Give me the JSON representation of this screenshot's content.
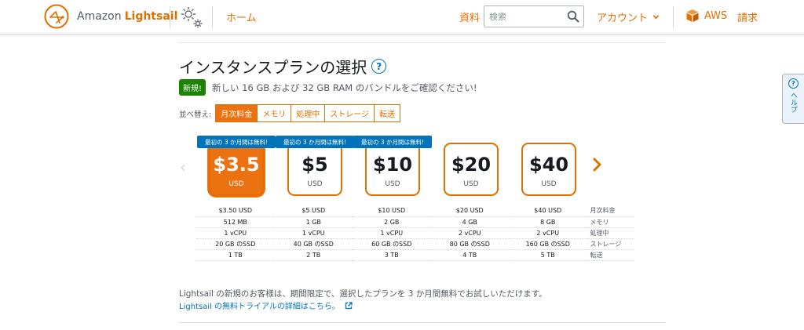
{
  "header": {
    "brand_prefix": "Amazon",
    "brand_name": "Lightsail",
    "home": "ホーム",
    "docs": "資料",
    "search_placeholder": "検索",
    "account": "アカウント",
    "aws": "AWS",
    "billing": "請求"
  },
  "page": {
    "title": "インスタンスプランの選択",
    "help_symbol": "?",
    "new_badge": "新規!",
    "new_text": "新しい 16 GB および 32 GB RAM のバンドルをご確認ください!"
  },
  "sort": {
    "label": "並べ替え:",
    "options": [
      "月次料金",
      "メモリ",
      "処理中",
      "ストレージ",
      "転送"
    ],
    "active": "月次料金"
  },
  "plans": [
    {
      "price": "$3.5",
      "currency": "USD",
      "promo": "最初の 3 か月間は無料!",
      "selected": true
    },
    {
      "price": "$5",
      "currency": "USD",
      "promo": "最初の 3 か月間は無料!",
      "selected": false
    },
    {
      "price": "$10",
      "currency": "USD",
      "promo": "最初の 3 か月間は無料!",
      "selected": false
    },
    {
      "price": "$20",
      "currency": "USD",
      "promo": "",
      "selected": false
    },
    {
      "price": "$40",
      "currency": "USD",
      "promo": "",
      "selected": false
    }
  ],
  "specs": {
    "rows": [
      {
        "label": "月次料金",
        "values": [
          "$3.50 USD",
          "$5 USD",
          "$10 USD",
          "$20 USD",
          "$40 USD"
        ]
      },
      {
        "label": "メモリ",
        "values": [
          "512 MB",
          "1 GB",
          "2 GB",
          "4 GB",
          "8 GB"
        ]
      },
      {
        "label": "処理中",
        "values": [
          "1 vCPU",
          "1 vCPU",
          "1 vCPU",
          "2 vCPU",
          "2 vCPU"
        ]
      },
      {
        "label": "ストレージ",
        "values": [
          "20 GB のSSD",
          "40 GB のSSD",
          "60 GB のSSD",
          "80 GB のSSD",
          "160 GB のSSD"
        ]
      },
      {
        "label": "転送",
        "values": [
          "1 TB",
          "2 TB",
          "3 TB",
          "4 TB",
          "5 TB"
        ]
      }
    ]
  },
  "footer": {
    "text": "Lightsail の新規のお客様は、期間限定で、選択したプランを 3 か月間無料でお試しいただけます。",
    "link": "Lightsail の無料トライアルの詳細はこちら。"
  },
  "help_tab": {
    "symbol": "?",
    "label": "ヘルプ"
  },
  "colors": {
    "accent": "#ec7211",
    "link": "#0073bb",
    "new_badge": "#1d8102"
  },
  "icons": [
    "lightsail-logo-icon",
    "gear-icon",
    "search-icon",
    "chevron-down-icon",
    "aws-box-icon",
    "chevron-left-icon",
    "chevron-right-icon",
    "external-link-icon",
    "help-icon"
  ]
}
